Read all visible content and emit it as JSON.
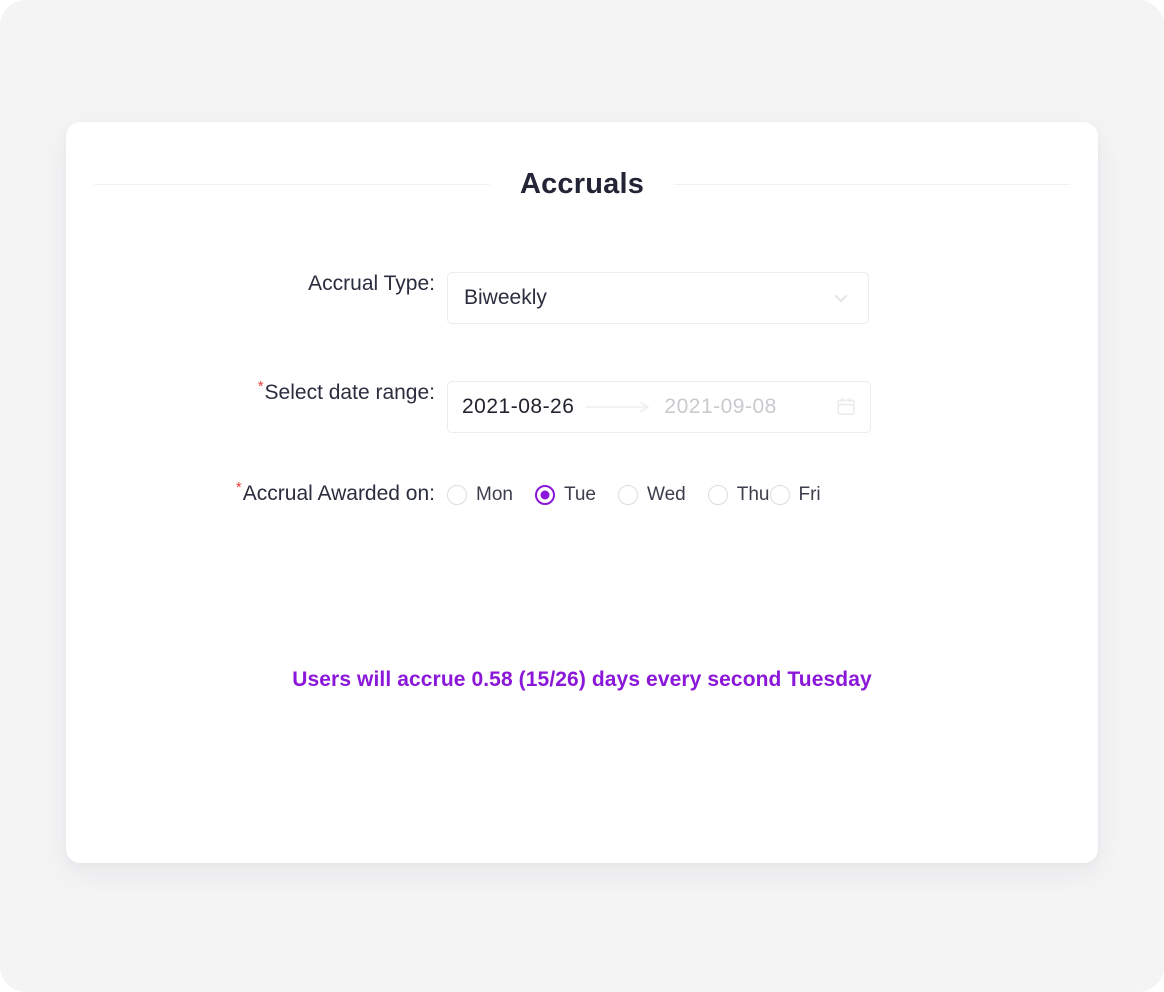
{
  "card": {
    "title": "Accruals"
  },
  "form": {
    "accrual_type": {
      "label": "Accrual Type:",
      "value": "Biweekly",
      "icon": "chevron-down-icon"
    },
    "date_range": {
      "label": "Select date range:",
      "required_marker": "*",
      "start_value": "2021-08-26",
      "end_placeholder": "2021-09-08",
      "separator_icon": "arrow-right-icon",
      "icon": "calendar-icon"
    },
    "awarded_on": {
      "label": "Accrual Awarded on:",
      "required_marker": "*",
      "selected": "Tue",
      "options": [
        {
          "label": "Mon",
          "selected": false
        },
        {
          "label": "Tue",
          "selected": true
        },
        {
          "label": "Wed",
          "selected": false
        },
        {
          "label": "Thu",
          "selected": false
        },
        {
          "label": "Fri",
          "selected": false
        }
      ]
    }
  },
  "summary": {
    "text": "Users will accrue 0.58 (15/26) days every second Tuesday"
  },
  "colors": {
    "accent_purple": "#8b17d9",
    "required_red": "#e8413b",
    "text_dark": "#2b2e3e",
    "placeholder_gray": "#c9cace",
    "page_background": "#f4f4f5",
    "card_background": "#ffffff",
    "border_gray": "#ececef"
  }
}
